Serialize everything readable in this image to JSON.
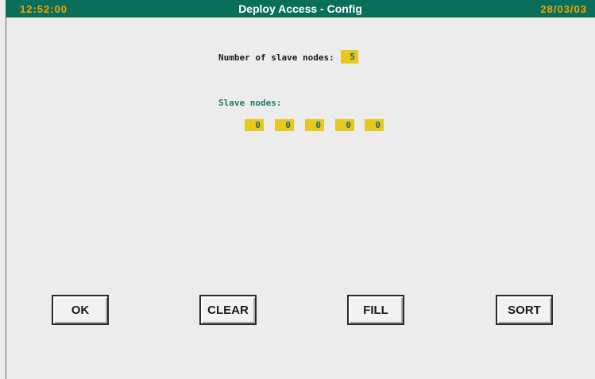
{
  "titlebar": {
    "time": "12:52:00",
    "title": "Deploy Access - Config",
    "date": "28/03/03"
  },
  "config": {
    "count_label": "Number of slave nodes:",
    "count_value": "5",
    "slave_label": "Slave nodes:",
    "nodes": [
      "0",
      "0",
      "0",
      "0",
      "0"
    ]
  },
  "buttons": {
    "ok": "OK",
    "clear": "CLEAR",
    "fill": "FILL",
    "sort": "SORT"
  },
  "colors": {
    "titlebar_bg": "#0a6f5a",
    "clock_text": "#f2a300",
    "field_bg": "#e6c81e",
    "label_accent": "#1a7a66"
  }
}
